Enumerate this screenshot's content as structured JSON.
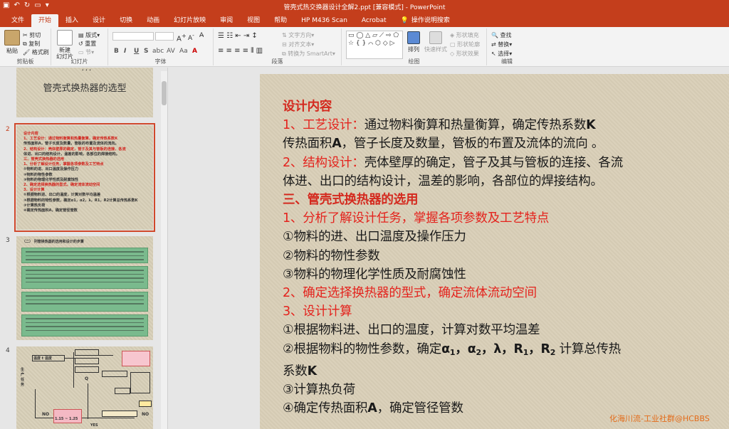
{
  "window": {
    "title": "管壳式热交换器设计全解2.ppt [兼容模式] - PowerPoint"
  },
  "tabs": [
    "文件",
    "开始",
    "插入",
    "设计",
    "切换",
    "动画",
    "幻灯片放映",
    "审阅",
    "视图",
    "帮助",
    "HP M436 Scan",
    "Acrobat"
  ],
  "active_tab": "开始",
  "tell_me": "操作说明搜索",
  "ribbon": {
    "clipboard": {
      "paste": "粘贴",
      "cut": "剪切",
      "copy": "复制",
      "format_painter": "格式刷",
      "label": "剪贴板"
    },
    "slides": {
      "new_slide": "新建\n幻灯片",
      "layout": "版式",
      "reset": "重置",
      "section": "节",
      "label": "幻灯片"
    },
    "font": {
      "label": "字体"
    },
    "paragraph": {
      "text_direction": "文字方向",
      "align_text": "对齐文本",
      "smartart": "转换为 SmartArt",
      "label": "段落"
    },
    "drawing": {
      "arrange": "排列",
      "quick_styles": "快速样式",
      "fill": "形状填充",
      "outline": "形状轮廓",
      "effects": "形状效果",
      "label": "绘图"
    },
    "editing": {
      "find": "查找",
      "replace": "替换",
      "select": "选择",
      "label": "编辑"
    }
  },
  "thumbnails": {
    "slide1": {
      "title": "管壳式换热器的选型"
    },
    "slide2": {
      "number": "2",
      "lines": [
        {
          "t": "设计内容",
          "red": true
        },
        {
          "t": "1、工艺设计：通过物料衡算和热量衡算，确定传热系数K",
          "red": true
        },
        {
          "t": "传热面积A，管子长度及数量，管板的布置及流体的流向。",
          "red": false
        },
        {
          "t": "2、结构设计：壳体壁厚的确定，管子及其与管板的连接、各流",
          "red": true
        },
        {
          "t": "体进、出口的结构设计，温差的影响，各部位的焊接结构。",
          "red": false
        },
        {
          "t": "三、管壳式换热器的选用",
          "red": true
        },
        {
          "t": "1、分析了解设计任务，掌握各项参数及工艺特点",
          "red": true
        },
        {
          "t": "①物料的进、出口温度及操作压力",
          "red": false
        },
        {
          "t": "②物料的物性参数",
          "red": false
        },
        {
          "t": "③物料的物理化学性质及耐腐蚀性",
          "red": false
        },
        {
          "t": "2、确定选择换热器的型式，确定流体流动空间",
          "red": true
        },
        {
          "t": "3、设计计算",
          "red": true
        },
        {
          "t": "①根据物料进、出口的温度，计算对数平均温差",
          "red": false
        },
        {
          "t": "②根据物料的物性参数，确定α1，α2，λ，R1，R2计算总传热系数K",
          "red": false
        },
        {
          "t": "③计算热负荷",
          "red": false
        },
        {
          "t": "④确定传热面积A，确定管径管数",
          "red": false
        }
      ]
    },
    "slide3": {
      "number": "3",
      "header": "（二）  列管换热器的选用和设计的步骤"
    },
    "slide4": {
      "number": "4",
      "labels": {
        "production_task": "生产任务",
        "temp": "温度 t 温度",
        "q": "Q",
        "no": "NO",
        "no2": "NO",
        "yes": "YES",
        "bottom_left": "1.15 ~ 1.25"
      }
    }
  },
  "slide": {
    "heading": "设计内容",
    "lines": [
      {
        "k": "r",
        "a": "1、工艺设计：",
        "b": "通过物料衡算和热量衡算，确定传热系数",
        "c": "K"
      },
      {
        "k": "b",
        "a": " 传热面积",
        "b": "A",
        "c": "，管子长度及数量，管板的布置及流体的流向 。"
      },
      {
        "k": "r",
        "a": "2、结构设计：",
        "b": "壳体壁厚的确定，管子及其与管板的连接、各流",
        "c": ""
      },
      {
        "k": "n",
        "a": "体进、出口的结构设计，温差的影响，各部位的焊接结构。",
        "b": "",
        "c": ""
      },
      {
        "k": "h",
        "a": "三、管壳式换热器的选用",
        "b": "",
        "c": ""
      },
      {
        "k": "rr",
        "a": "1、分析了解设计任务，掌握各项参数及工艺特点",
        "b": "",
        "c": ""
      },
      {
        "k": "n",
        "a": "①物料的进、出口温度及操作压力",
        "b": "",
        "c": ""
      },
      {
        "k": "n",
        "a": "②物料的物性参数",
        "b": "",
        "c": ""
      },
      {
        "k": "n",
        "a": "③物料的物理化学性质及耐腐蚀性",
        "b": "",
        "c": ""
      },
      {
        "k": "rr",
        "a": "2、确定选择换热器的型式，确定流体流动空间",
        "b": "",
        "c": ""
      },
      {
        "k": "rr",
        "a": "3、设计计算",
        "b": "",
        "c": ""
      },
      {
        "k": "n",
        "a": "①根据物料进、出口的温度，计算对数平均温差",
        "b": "",
        "c": ""
      }
    ],
    "line13_prefix": "②根据物料的物性参数，确定",
    "line13_formula": "α1，α2，λ，R1，R2",
    "line13_suffix": " 计算总传热",
    "line14": "系数",
    "line14_k": "K",
    "line15": "③计算热负荷",
    "line16_a": "④确定传热面积",
    "line16_b": "A",
    "line16_c": "，确定管径管数"
  },
  "watermark": "化海川流-工业社群@HCBBS",
  "colors": {
    "accent": "#c43e1c",
    "slide_red": "#e4231d",
    "slide_bg": "#d9cfb7"
  }
}
